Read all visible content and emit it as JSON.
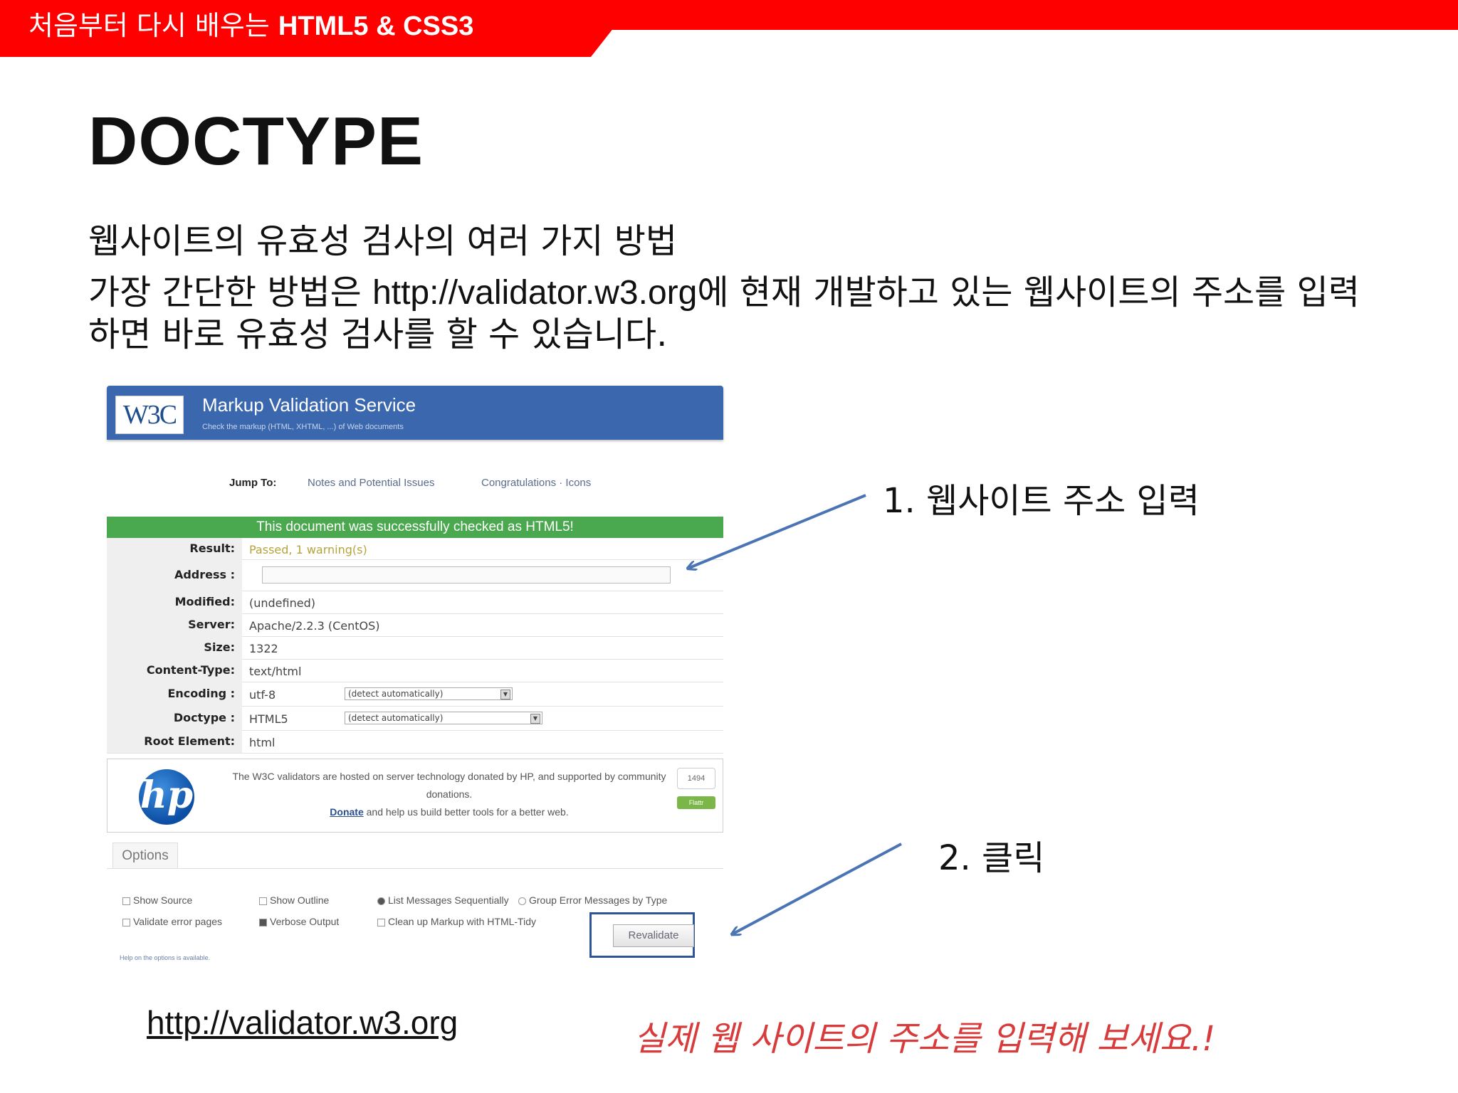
{
  "banner": {
    "prefix": "처음부터 다시 배우는 ",
    "book": "HTML5 & CSS3"
  },
  "slide": {
    "title": "DOCTYPE",
    "line1": "웹사이트의 유효성 검사의 여러 가지 방법",
    "line2_pre": "가장 간단한 방법은 ",
    "line2_url": "http://validator.w3.org",
    "line2_post": "에 현재 개발하고 있는 웹사이트의 주소를 입력하면 바로 유효성 검사를 할 수 있습니다."
  },
  "validator": {
    "logo": "W3C",
    "title": "Markup Validation Service",
    "subtitle": "Check the markup (HTML, XHTML, ...) of Web documents",
    "jump_label": "Jump To:",
    "jump_link1": "Notes and Potential Issues",
    "jump_link2": "Congratulations · Icons",
    "success": "This document was successfully checked as HTML5!",
    "rows": {
      "result": {
        "k": "Result:",
        "v": "Passed, 1 warning(s)"
      },
      "address": {
        "k": "Address :"
      },
      "modified": {
        "k": "Modified:",
        "v": "(undefined)"
      },
      "server": {
        "k": "Server:",
        "v": "Apache/2.2.3 (CentOS)"
      },
      "size": {
        "k": "Size:",
        "v": "1322"
      },
      "content_type": {
        "k": "Content-Type:",
        "v": "text/html"
      },
      "encoding": {
        "k": "Encoding :",
        "v": "utf-8",
        "select": "(detect automatically)"
      },
      "doctype": {
        "k": "Doctype :",
        "v": "HTML5",
        "select": "(detect automatically)"
      },
      "root": {
        "k": "Root Element:",
        "v": "html"
      }
    },
    "hp": {
      "logo": "hp",
      "text1": "The W3C validators are hosted on server technology donated by HP, and supported by community donations.",
      "donate": "Donate",
      "text2": " and help us build better tools for a better web.",
      "count": "1494",
      "flattr": "Flattr"
    },
    "options": {
      "tab": "Options",
      "show_source": "Show Source",
      "show_outline": "Show Outline",
      "list_messages": "List Messages Sequentially",
      "group_errors": "Group Error Messages by Type",
      "validate_error_pages": "Validate error pages",
      "verbose_output": "Verbose Output",
      "clean_up": "Clean up Markup with HTML-Tidy",
      "help": "Help on the options is available.",
      "revalidate": "Revalidate"
    }
  },
  "annotations": {
    "step1": "1. 웹사이트 주소 입력",
    "step2": "2. 클릭"
  },
  "footer": {
    "url": "http://validator.w3.org",
    "callout": "실제 웹 사이트의 주소를 입력해 보세요.!"
  },
  "colors": {
    "banner": "#ff0000",
    "arrow": "#4a74b4",
    "callout": "#d83b3b",
    "success": "#4aa84e"
  }
}
